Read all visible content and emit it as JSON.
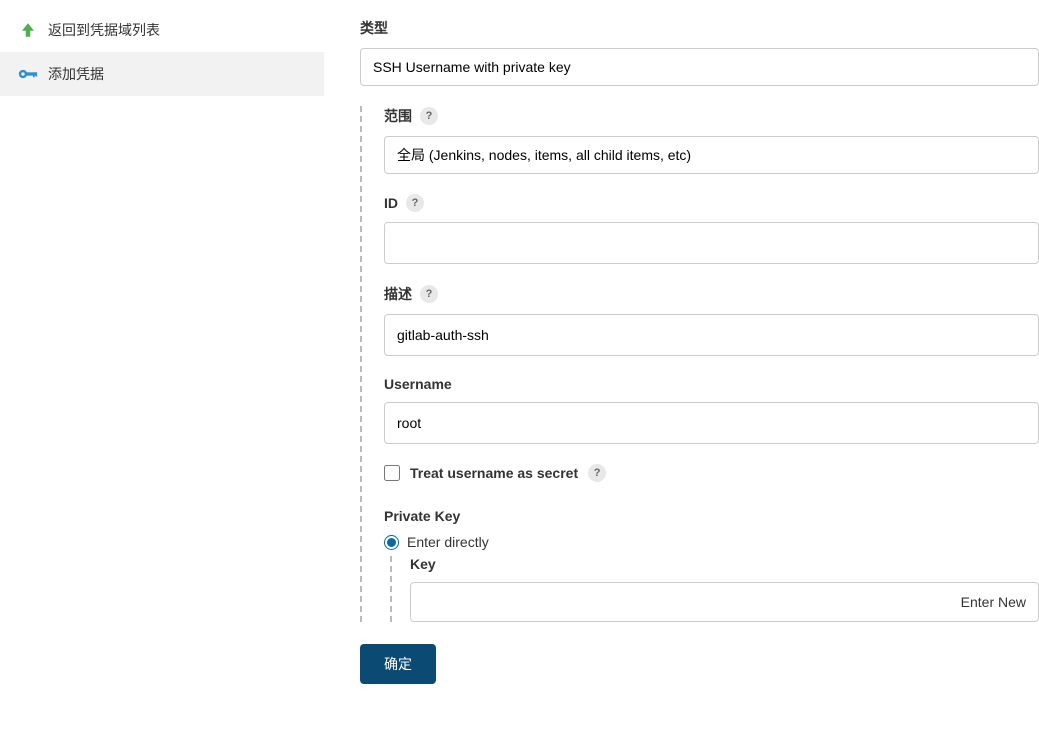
{
  "sidebar": {
    "items": [
      {
        "label": "返回到凭据域列表",
        "icon": "arrow-up"
      },
      {
        "label": "添加凭据",
        "icon": "key"
      }
    ]
  },
  "form": {
    "type_label": "类型",
    "type_value": "SSH Username with private key",
    "scope_label": "范围",
    "scope_value": "全局 (Jenkins, nodes, items, all child items, etc)",
    "id_label": "ID",
    "id_value": "",
    "description_label": "描述",
    "description_value": "gitlab-auth-ssh",
    "username_label": "Username",
    "username_value": "root",
    "treat_secret_label": "Treat username as secret",
    "private_key_label": "Private Key",
    "enter_directly_label": "Enter directly",
    "key_label": "Key",
    "key_placeholder": "Enter New",
    "submit_label": "确定"
  }
}
